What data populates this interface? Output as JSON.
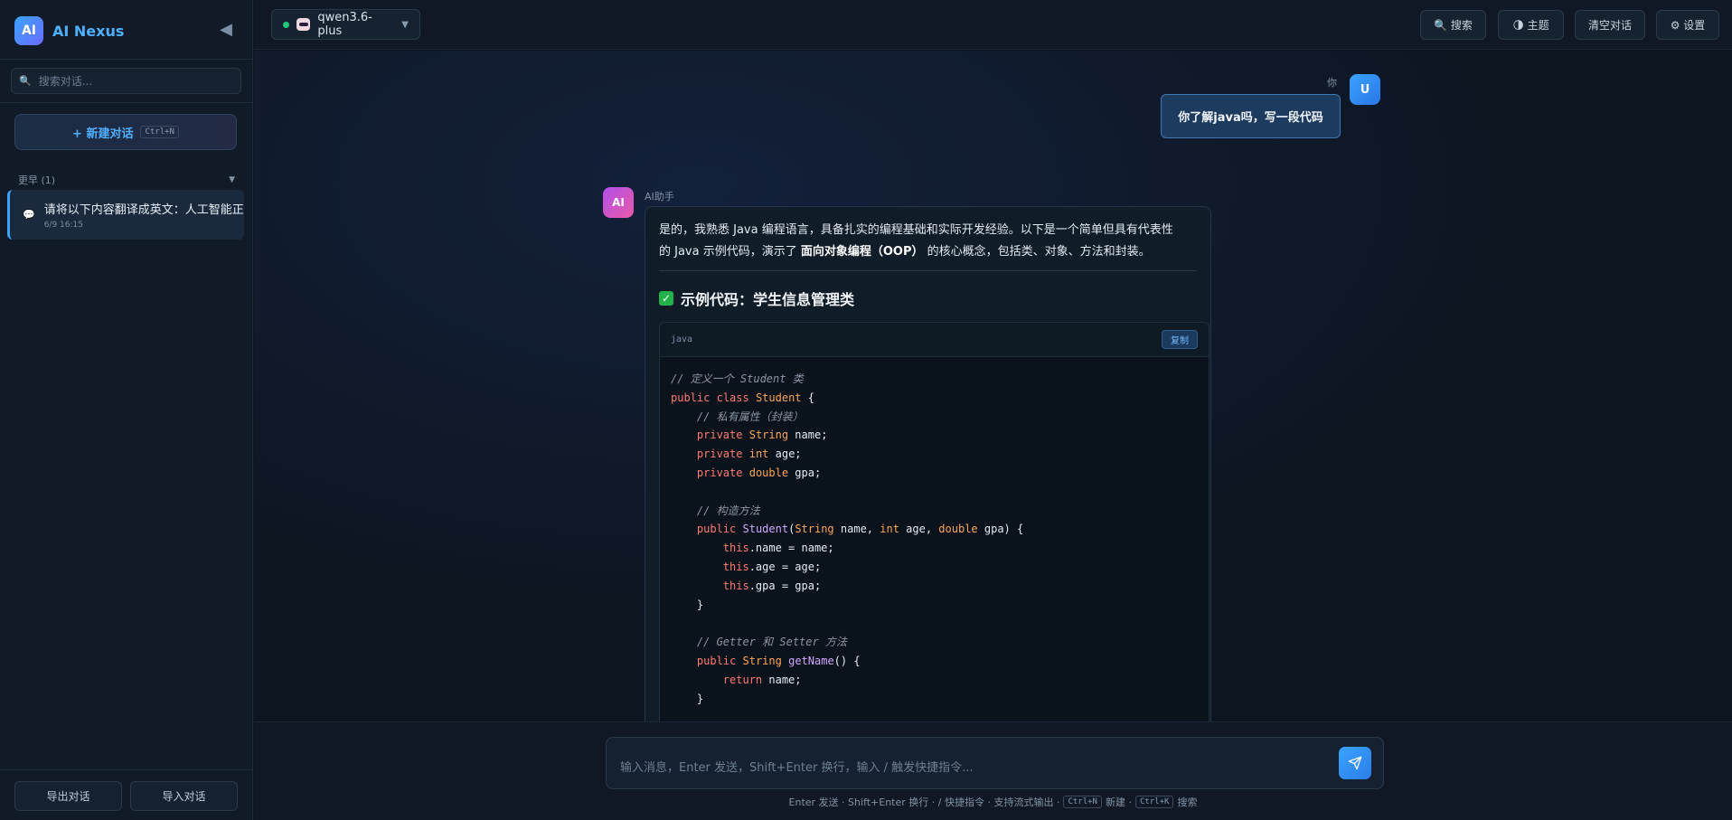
{
  "app": {
    "logo_text": "AI",
    "name": "AI Nexus",
    "collapse_icon": "◀"
  },
  "sidebar": {
    "search_placeholder": "搜索对话...",
    "new_chat": {
      "label": "+ 新建对话",
      "shortcut": "Ctrl+N"
    },
    "group": {
      "label": "更早 (1)",
      "toggle_icon": "▼"
    },
    "conversations": [
      {
        "title": "请将以下内容翻译成英文：人工智能正",
        "time": "6/9 16:15"
      }
    ],
    "export_label": "导出对话",
    "import_label": "导入对话"
  },
  "topbar": {
    "model": {
      "name": "qwen3.6-plus",
      "status_color": "#1fc87a"
    },
    "buttons": {
      "search": "🔍 搜索",
      "theme": "🌗 主题",
      "clear": "清空对话",
      "settings": "⚙ 设置"
    }
  },
  "chat": {
    "user": {
      "label": "你",
      "avatar": "U",
      "message": "你了解java吗，写一段代码"
    },
    "assistant": {
      "label": "AI助手",
      "avatar": "AI",
      "intro_line1": "是的，我熟悉 Java 编程语言，具备扎实的编程基础和实际开发经验。以下是一个简单但具有代表性",
      "intro_line2_pre": "的 Java 示例代码，演示了 ",
      "intro_line2_bold": "面向对象编程（OOP）",
      "intro_line2_post": " 的核心概念，包括类、对象、方法和封装。",
      "section_title": "示例代码：学生信息管理类",
      "code": {
        "language": "java",
        "copy_label": "复制",
        "lines": [
          "// 定义一个 Student 类",
          "public class Student {",
          "    // 私有属性（封装）",
          "    private String name;",
          "    private int age;",
          "    private double gpa;",
          "",
          "    // 构造方法",
          "    public Student(String name, int age, double gpa) {",
          "        this.name = name;",
          "        this.age = age;",
          "        this.gpa = gpa;",
          "    }",
          "",
          "    // Getter 和 Setter 方法",
          "    public String getName() {",
          "        return name;",
          "    }"
        ]
      }
    }
  },
  "input": {
    "placeholder": "输入消息，Enter 发送，Shift+Enter 换行，输入 / 触发快捷指令...",
    "hint_pre": "Enter 发送 · Shift+Enter 换行 · / 快捷指令 · 支持流式输出 ·",
    "hint_kbd1": "Ctrl+N",
    "hint_mid": "新建 ·",
    "hint_kbd2": "Ctrl+K",
    "hint_post": "搜索"
  }
}
